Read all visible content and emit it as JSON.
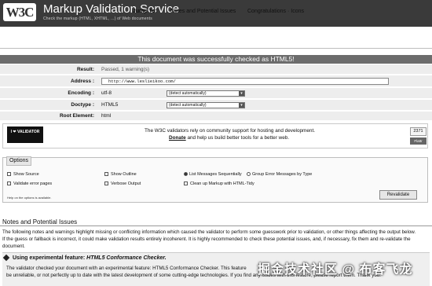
{
  "header": {
    "logo": "W3C",
    "title": "Markup Validation Service",
    "tagline": "Check the markup (HTML, XHTML, ...) of Web documents"
  },
  "jump": {
    "label": "Jump To:",
    "links": [
      "Notes and Potential Issues",
      "Congratulations · Icons"
    ]
  },
  "banner": "This document was successfully checked as HTML5!",
  "results": {
    "result_label": "Result:",
    "result_value": "Passed, 1 warning(s)",
    "address_label": "Address :",
    "address_value": "http://www.leslieikoo.com/",
    "encoding_label": "Encoding :",
    "encoding_value": "utf-8",
    "encoding_select": "(detect automatically)",
    "doctype_label": "Doctype :",
    "doctype_value": "HTML5",
    "doctype_select": "(detect automatically)",
    "root_label": "Root Element:",
    "root_value": "html"
  },
  "donate": {
    "badge": "I ❤ VALIDATOR",
    "line1": "The W3C validators rely on community support for hosting and development.",
    "link": "Donate",
    "line2": " and help us build better tools for a better web.",
    "flattr_count": "2371",
    "flattr_label": "Flattr"
  },
  "options": {
    "legend": "Options",
    "items": [
      "Show Source",
      "Show Outline",
      "List Messages Sequentially",
      "Group Error Messages by Type",
      "Validate error pages",
      "Verbose Output",
      "Clean up Markup with HTML-Tidy"
    ],
    "help_note": "Help on the options is available.",
    "revalidate": "Revalidate"
  },
  "notes": {
    "title": "Notes and Potential Issues",
    "para1": "The following notes and warnings highlight missing or conflicting information which caused the validator to perform some guesswork prior to validation, or other things affecting the output below.",
    "para2": "If the guess or fallback is incorrect, it could make validation results entirely incoherent. It is highly recommended to check these potential issues, and, if necessary, fix them and re-validate the",
    "para3": "document.",
    "warn_title_prefix": "Using experimental feature: ",
    "warn_title_feature": "HTML5 Conformance Checker.",
    "warn_line1": "The validator checked your document with an experimental feature: HTML5 Conformance Checker. This feature",
    "warn_line2": "be unreliable, or not perfectly up to date with the latest development of some cutting-edge technologies. If you find any issues with this feature, please report them. Thank you."
  },
  "watermark": "掘金技术社区 @ 布客飞龙",
  "colors": {
    "header_bg": "#3a3a3a",
    "banner_bg": "#6c6c6c",
    "row_bg": "#ededed"
  }
}
